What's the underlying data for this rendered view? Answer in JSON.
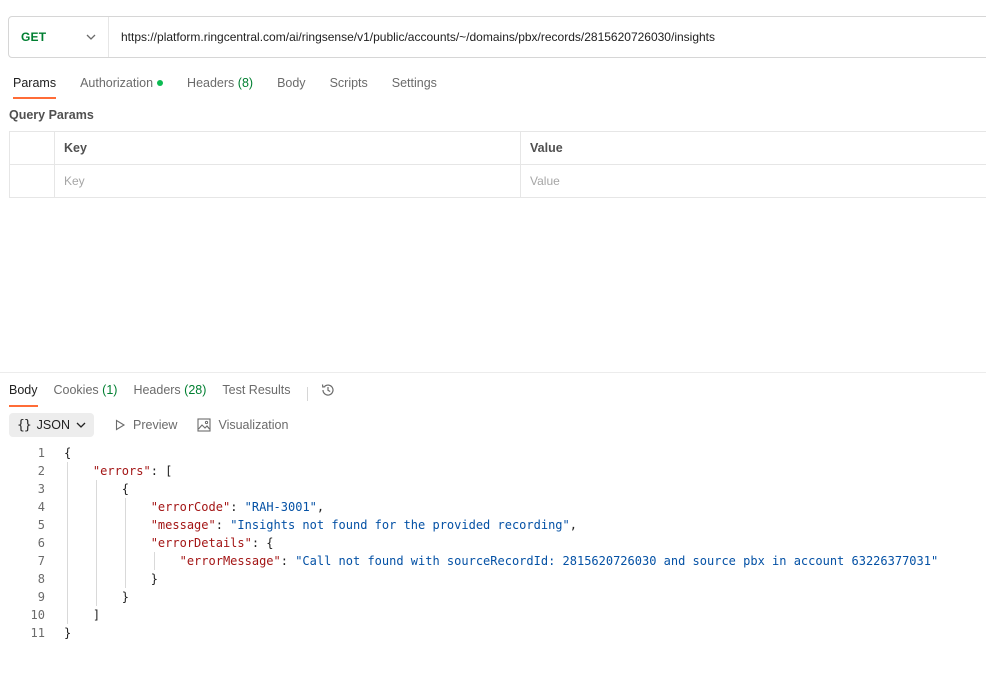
{
  "request": {
    "method": "GET",
    "url": "https://platform.ringcentral.com/ai/ringsense/v1/public/accounts/~/domains/pbx/records/2815620726030/insights"
  },
  "request_tabs": [
    {
      "label": "Params",
      "count": ""
    },
    {
      "label": "Authorization",
      "count": ""
    },
    {
      "label": "Headers",
      "count": "(8)"
    },
    {
      "label": "Body",
      "count": ""
    },
    {
      "label": "Scripts",
      "count": ""
    },
    {
      "label": "Settings",
      "count": ""
    }
  ],
  "query_params": {
    "title": "Query Params",
    "columns": [
      "Key",
      "Value"
    ],
    "placeholder_key": "Key",
    "placeholder_value": "Value"
  },
  "response_tabs": [
    {
      "label": "Body",
      "count": ""
    },
    {
      "label": "Cookies",
      "count": "(1)"
    },
    {
      "label": "Headers",
      "count": "(28)"
    },
    {
      "label": "Test Results",
      "count": ""
    }
  ],
  "response_toolbar": {
    "format_braces": "{}",
    "format_label": "JSON",
    "preview_label": "Preview",
    "visualization_label": "Visualization"
  },
  "response_body": {
    "line_numbers": [
      "1",
      "2",
      "3",
      "4",
      "5",
      "6",
      "7",
      "8",
      "9",
      "10",
      "11"
    ],
    "errors_key": "\"errors\"",
    "error_code_key": "\"errorCode\"",
    "error_code_value": "\"RAH-3001\"",
    "message_key": "\"message\"",
    "message_value": "\"Insights not found for the provided recording\"",
    "error_details_key": "\"errorDetails\"",
    "error_message_key": "\"errorMessage\"",
    "error_message_value": "\"Call not found with sourceRecordId: 2815620726030 and source pbx in account 63226377031\""
  },
  "colors": {
    "method_green": "#007f31",
    "active_tab_accent": "#ff6c37",
    "auth_dot": "#0cbb52",
    "json_key": "#a31515",
    "json_string": "#0451a5"
  }
}
